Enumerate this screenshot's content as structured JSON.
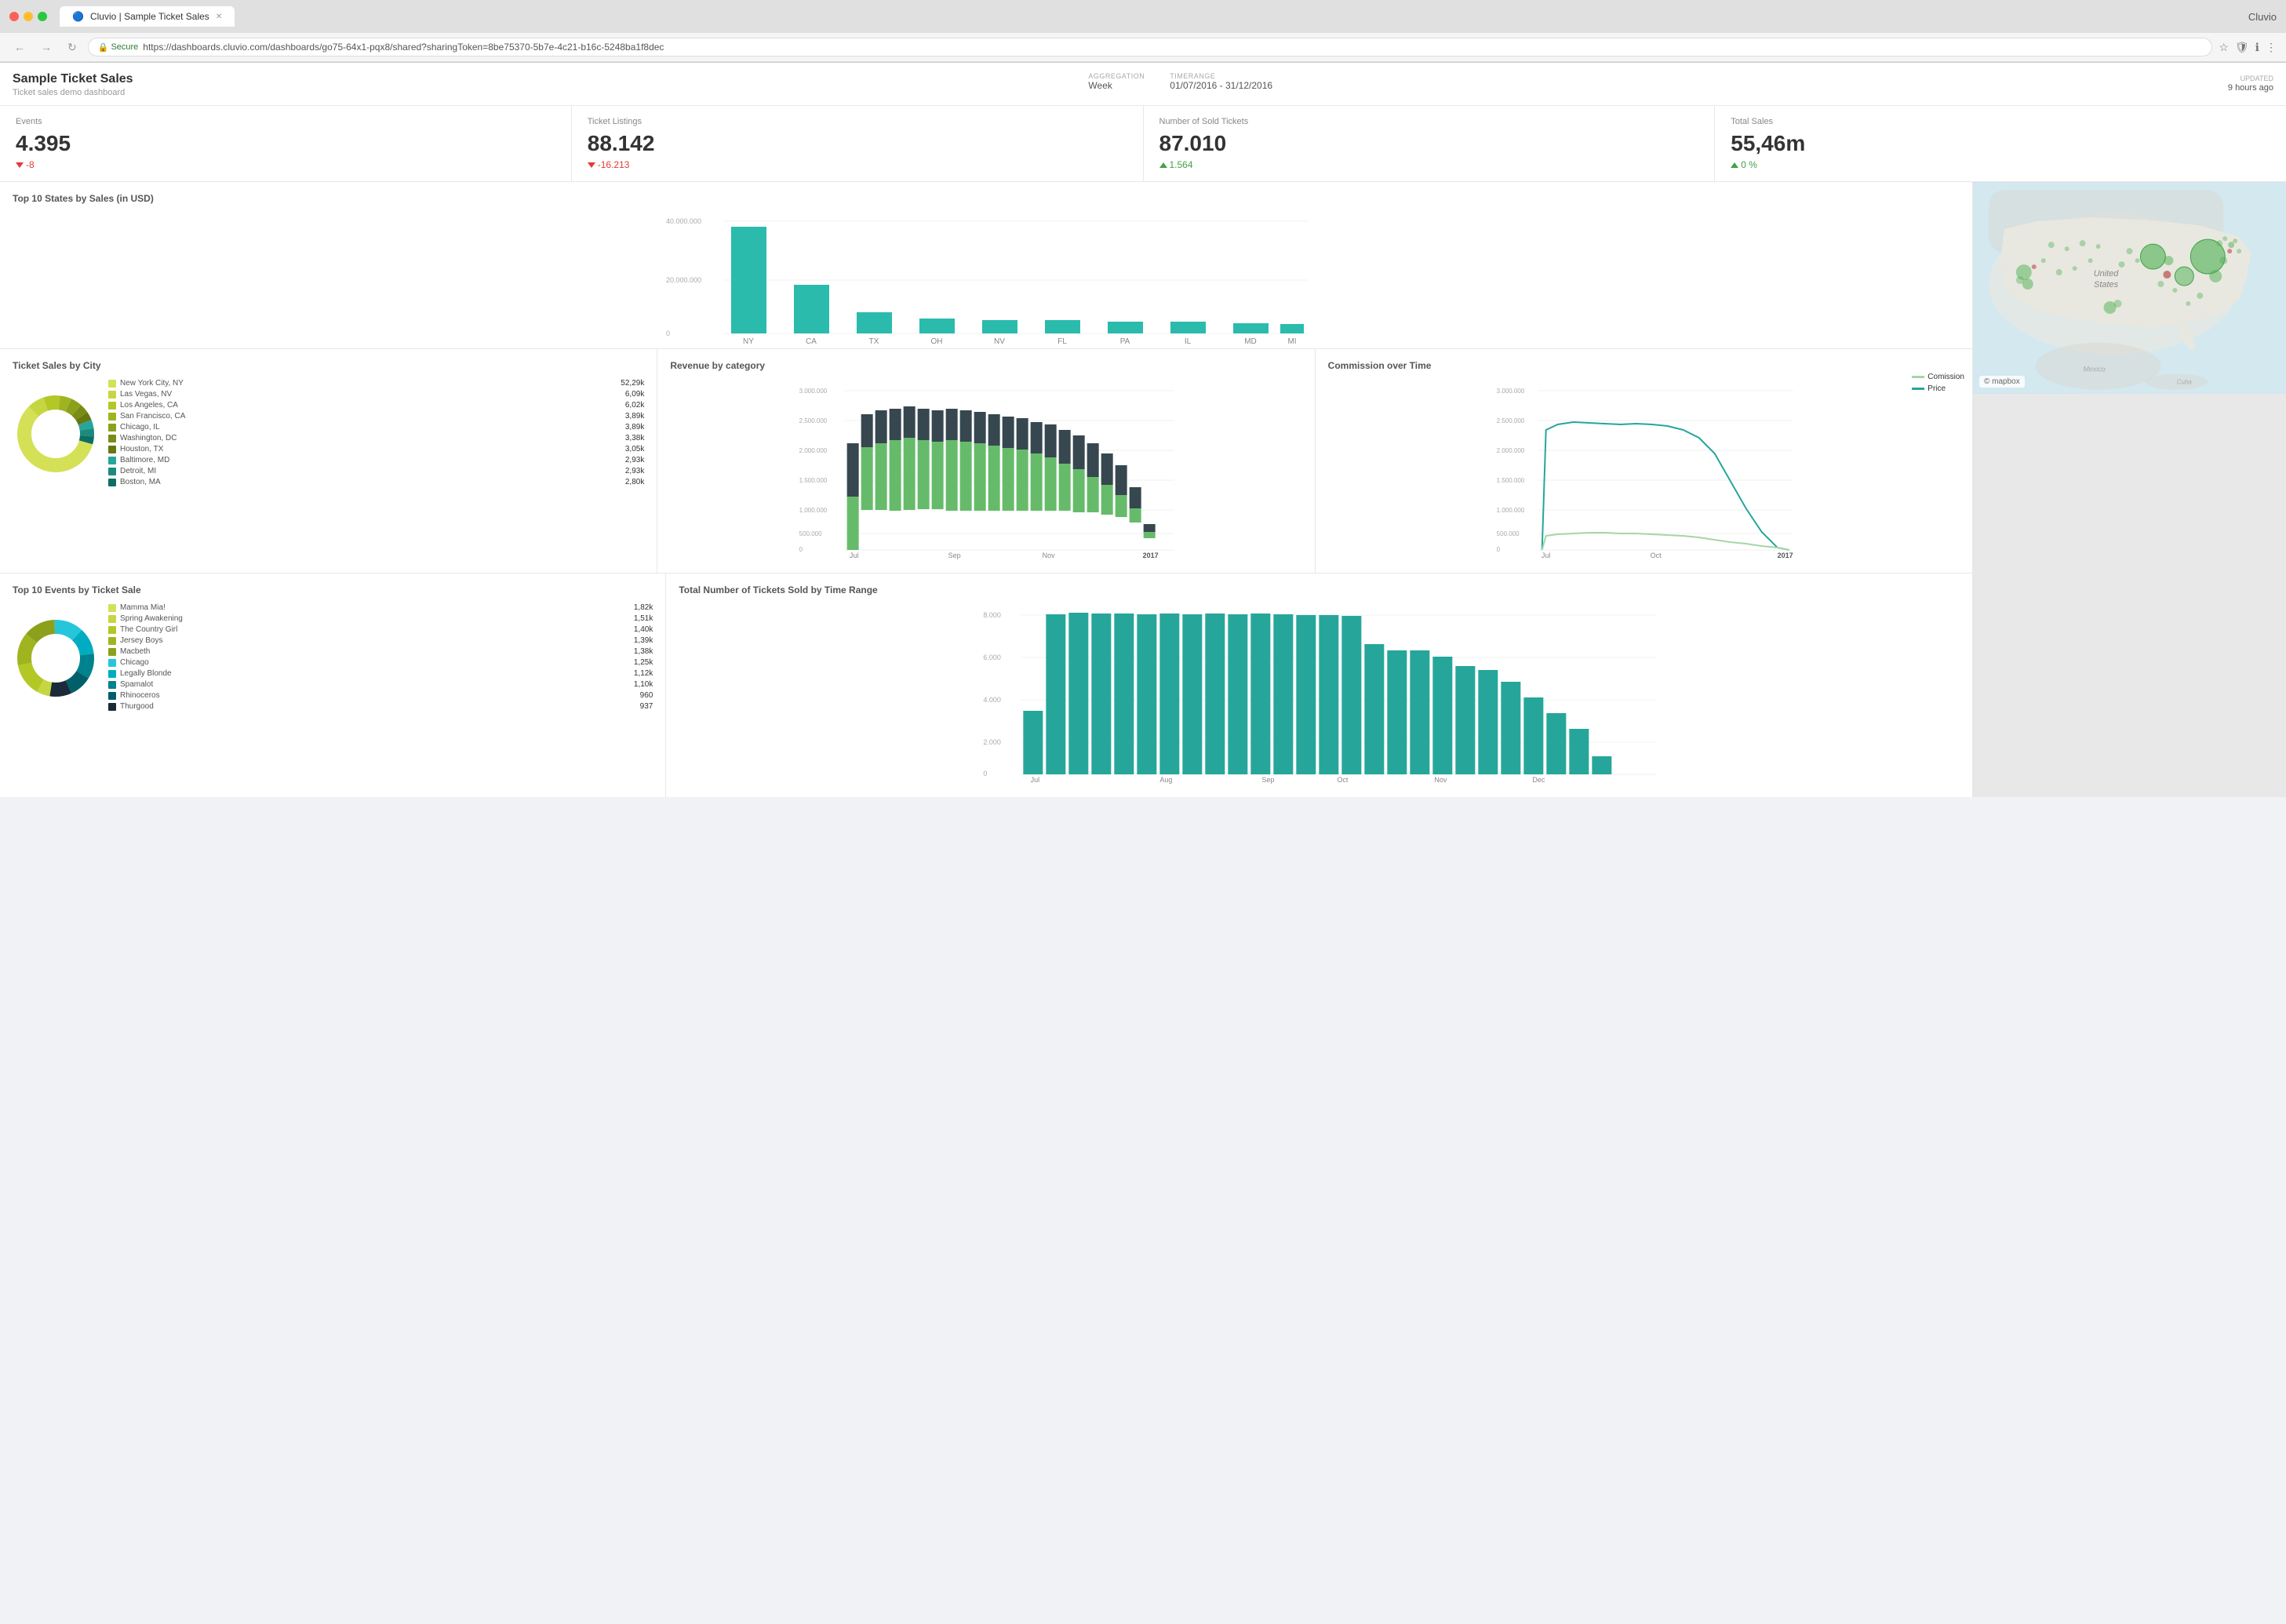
{
  "browser": {
    "title": "Cluvio",
    "tab_title": "Cluvio | Sample Ticket Sales",
    "url": "https://dashboards.cluvio.com/dashboards/go75-64x1-pqx8/shared?sharingToken=8be75370-5b7e-4c21-b16c-5248ba1f8dec",
    "secure_text": "Secure"
  },
  "header": {
    "title": "Sample Ticket Sales",
    "subtitle": "Ticket sales demo dashboard",
    "aggregation_label": "AGGREGATION",
    "aggregation_value": "Week",
    "timerange_label": "TIMERANGE",
    "timerange_value": "01/07/2016 - 31/12/2016",
    "updated_label": "UPDATED",
    "updated_value": "9 hours ago"
  },
  "kpis": [
    {
      "label": "Events",
      "value": "4.395",
      "delta": "-8",
      "delta_type": "neg"
    },
    {
      "label": "Ticket Listings",
      "value": "88.142",
      "delta": "-16.213",
      "delta_type": "neg"
    },
    {
      "label": "Number of Sold Tickets",
      "value": "87.010",
      "delta": "1.564",
      "delta_type": "pos"
    },
    {
      "label": "Total Sales",
      "value": "55,46m",
      "delta": "0 %",
      "delta_type": "pos"
    }
  ],
  "top_states": {
    "title": "Top 10 States by Sales (in USD)",
    "states": [
      "NY",
      "CA",
      "TX",
      "OH",
      "NV",
      "FL",
      "PA",
      "IL",
      "MD",
      "MI"
    ],
    "values": [
      35000000,
      16000000,
      7000000,
      5000000,
      4500000,
      4500000,
      4000000,
      4000000,
      3500000,
      3000000
    ],
    "y_labels": [
      "40.000.000",
      "20.000.000",
      "0"
    ],
    "color": "#2bbbad"
  },
  "ticket_sales_city": {
    "title": "Ticket Sales by City",
    "items": [
      {
        "label": "New York City, NY",
        "value": "52,29k",
        "color": "#d4e157"
      },
      {
        "label": "Las Vegas, NV",
        "value": "6,09k",
        "color": "#c6d642"
      },
      {
        "label": "Los Angeles, CA",
        "value": "6,02k",
        "color": "#b3c825"
      },
      {
        "label": "San Francisco, CA",
        "value": "3,89k",
        "color": "#a0b420"
      },
      {
        "label": "Chicago, IL",
        "value": "3,89k",
        "color": "#8da01b"
      },
      {
        "label": "Washington, DC",
        "value": "3,38k",
        "color": "#7a8c16"
      },
      {
        "label": "Houston, TX",
        "value": "3,05k",
        "color": "#677811"
      },
      {
        "label": "Baltimore, MD",
        "value": "2,93k",
        "color": "#26a69a"
      },
      {
        "label": "Detroit, MI",
        "value": "2,93k",
        "color": "#1d8a80"
      },
      {
        "label": "Boston, MA",
        "value": "2,80k",
        "color": "#0d6e66"
      }
    ]
  },
  "revenue_category": {
    "title": "Revenue by category",
    "x_labels": [
      "Jul",
      "Sep",
      "Nov",
      "2017"
    ],
    "y_labels": [
      "3.000.000",
      "2.500.000",
      "2.000.000",
      "1.500.000",
      "1.000.000",
      "500.000",
      "0"
    ],
    "colors": {
      "green": "#66bb6a",
      "dark": "#37474f"
    }
  },
  "commission": {
    "title": "Commission over Time",
    "y_labels": [
      "3.000.000",
      "2.500.000",
      "2.000.000",
      "1.500.000",
      "1.000.000",
      "500.000",
      "0"
    ],
    "x_labels": [
      "Jul",
      "Oct",
      "2017"
    ],
    "legend": [
      {
        "label": "Comission",
        "color": "#a5d6a7"
      },
      {
        "label": "Price",
        "color": "#26a69a"
      }
    ]
  },
  "top_events": {
    "title": "Top 10 Events by Ticket Sale",
    "items": [
      {
        "label": "Mamma Mia!",
        "value": "1,82k",
        "color": "#d4e157"
      },
      {
        "label": "Spring Awakening",
        "value": "1,51k",
        "color": "#c6d642"
      },
      {
        "label": "The Country Girl",
        "value": "1,40k",
        "color": "#b3c825"
      },
      {
        "label": "Jersey Boys",
        "value": "1,39k",
        "color": "#a0b420"
      },
      {
        "label": "Macbeth",
        "value": "1,38k",
        "color": "#8da01b"
      },
      {
        "label": "Chicago",
        "value": "1,25k",
        "color": "#26c6da"
      },
      {
        "label": "Legally Blonde",
        "value": "1,12k",
        "color": "#00acc1"
      },
      {
        "label": "Spamalot",
        "value": "1,10k",
        "color": "#00838f"
      },
      {
        "label": "Rhinoceros",
        "value": "960",
        "color": "#005f6b"
      },
      {
        "label": "Thurgood",
        "value": "937",
        "color": "#1a2a3a"
      }
    ]
  },
  "total_tickets": {
    "title": "Total Number of Tickets Sold by Time Range",
    "x_labels": [
      "Jul",
      "Aug",
      "Sep",
      "Oct",
      "Nov",
      "Dec"
    ],
    "y_labels": [
      "8.000",
      "6.000",
      "4.000",
      "2.000",
      "0"
    ],
    "color": "#26a69a"
  }
}
